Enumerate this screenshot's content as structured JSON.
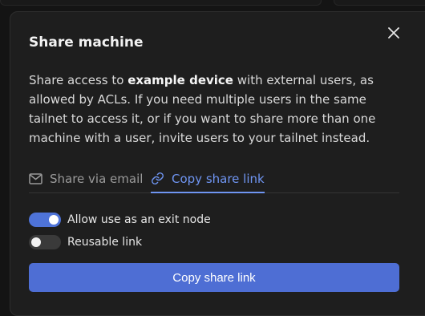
{
  "dialog": {
    "title": "Share machine",
    "description": {
      "before": "Share access to ",
      "device": "example device",
      "after": " with external users, as allowed by ACLs. If you need multiple users in the same tailnet to access it, or if you want to share more than one machine with a user, invite users to your tailnet instead."
    },
    "tabs": [
      {
        "label": "Share via email",
        "icon": "mail-icon",
        "active": false
      },
      {
        "label": "Copy share link",
        "icon": "link-icon",
        "active": true
      }
    ],
    "toggles": [
      {
        "label": "Allow use as an exit node",
        "checked": true
      },
      {
        "label": "Reusable link",
        "checked": false
      }
    ],
    "primary_button": "Copy share link"
  },
  "colors": {
    "accent": "#6f95f2",
    "button": "#4e6ed4",
    "toggle_on": "#4e73d8",
    "dialog_bg": "#1e1e1e"
  }
}
